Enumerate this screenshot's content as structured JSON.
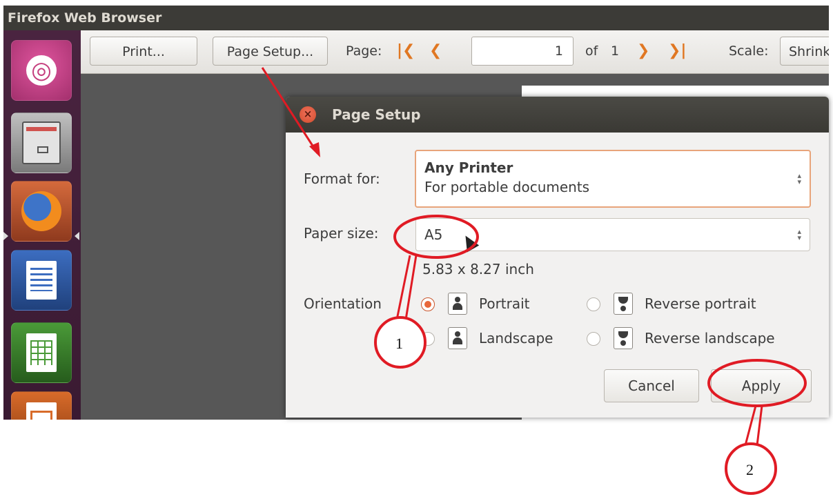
{
  "window": {
    "title": "Firefox Web Browser"
  },
  "toolbar": {
    "print_label": "Print...",
    "page_setup_label": "Page Setup...",
    "page_label": "Page:",
    "page_value": "1",
    "of_label": "of",
    "total_pages": "1",
    "scale_label": "Scale:",
    "scale_value": "Shrink"
  },
  "dialog": {
    "title": "Page Setup",
    "format_for_label": "Format for:",
    "format_for_title": "Any Printer",
    "format_for_subtitle": "For portable documents",
    "paper_size_label": "Paper size:",
    "paper_size_value": "A5",
    "paper_dimensions": "5.83 x 8.27 inch",
    "orientation_label": "Orientation",
    "options": {
      "portrait": "Portrait",
      "reverse_portrait": "Reverse portrait",
      "landscape": "Landscape",
      "reverse_landscape": "Reverse landscape"
    },
    "selected_orientation": "Portrait",
    "cancel_label": "Cancel",
    "apply_label": "Apply"
  },
  "annotations": {
    "callout_1": "1",
    "callout_2": "2",
    "accent_color": "#e01b24"
  },
  "colors": {
    "titlebar": "#3c3b37",
    "launcher": "#4a2440",
    "dialog_bg": "#f2f1f0",
    "nav_arrows": "#e07722",
    "radio_selected": "#e8673a"
  }
}
